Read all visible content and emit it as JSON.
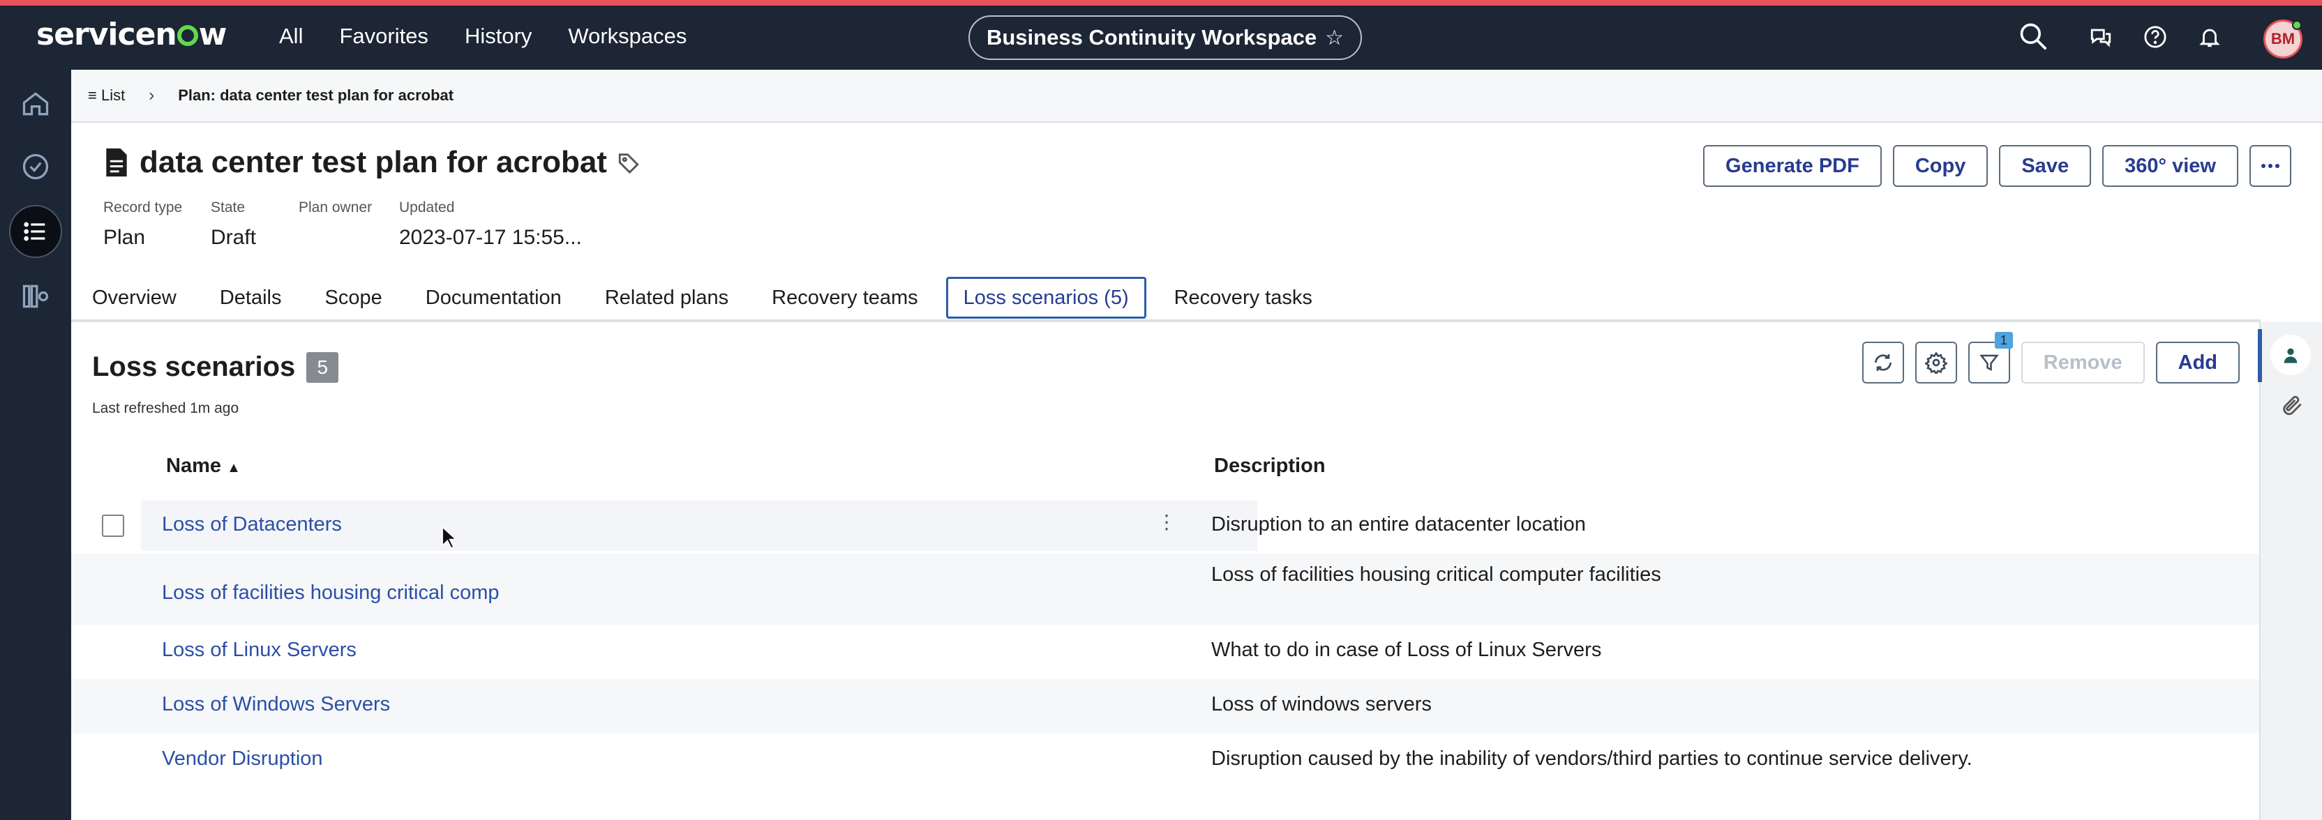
{
  "topnav": {
    "logo": "servicenow",
    "links": [
      "All",
      "Favorites",
      "History",
      "Workspaces"
    ],
    "workspace": "Business Continuity Workspace",
    "avatar_initials": "BM"
  },
  "breadcrumb": {
    "list_label": "List",
    "current": "Plan: data center test plan for acrobat"
  },
  "record": {
    "title": "data center test plan for acrobat",
    "fields": [
      {
        "label": "Record type",
        "value": "Plan"
      },
      {
        "label": "State",
        "value": "Draft"
      },
      {
        "label": "Plan owner",
        "value": ""
      },
      {
        "label": "Updated",
        "value": "2023-07-17 15:55..."
      }
    ],
    "actions": [
      "Generate PDF",
      "Copy",
      "Save",
      "360° view"
    ]
  },
  "tabs": [
    "Overview",
    "Details",
    "Scope",
    "Documentation",
    "Related plans",
    "Recovery teams",
    "Loss scenarios (5)",
    "Recovery tasks"
  ],
  "list": {
    "title": "Loss scenarios",
    "count": "5",
    "refreshed": "Last refreshed 1m ago",
    "filter_count": "1",
    "remove_label": "Remove",
    "add_label": "Add",
    "columns": [
      "Name",
      "Description"
    ],
    "rows": [
      {
        "name": "Loss of Datacenters",
        "description": "Disruption to an entire datacenter location"
      },
      {
        "name": "Loss of facilities housing critical comp",
        "description": "Loss of facilities housing critical computer facilities"
      },
      {
        "name": "Loss of Linux Servers",
        "description": "What to do in case of Loss of Linux Servers"
      },
      {
        "name": "Loss of Windows Servers",
        "description": "Loss of windows servers"
      },
      {
        "name": "Vendor Disruption",
        "description": "Disruption caused by the inability of vendors/third parties to continue service delivery."
      }
    ]
  },
  "colors": {
    "nav_bg": "#1c2634",
    "accent_top": "#e8505b",
    "link": "#2b4fa7",
    "button_text": "#273b8f"
  }
}
